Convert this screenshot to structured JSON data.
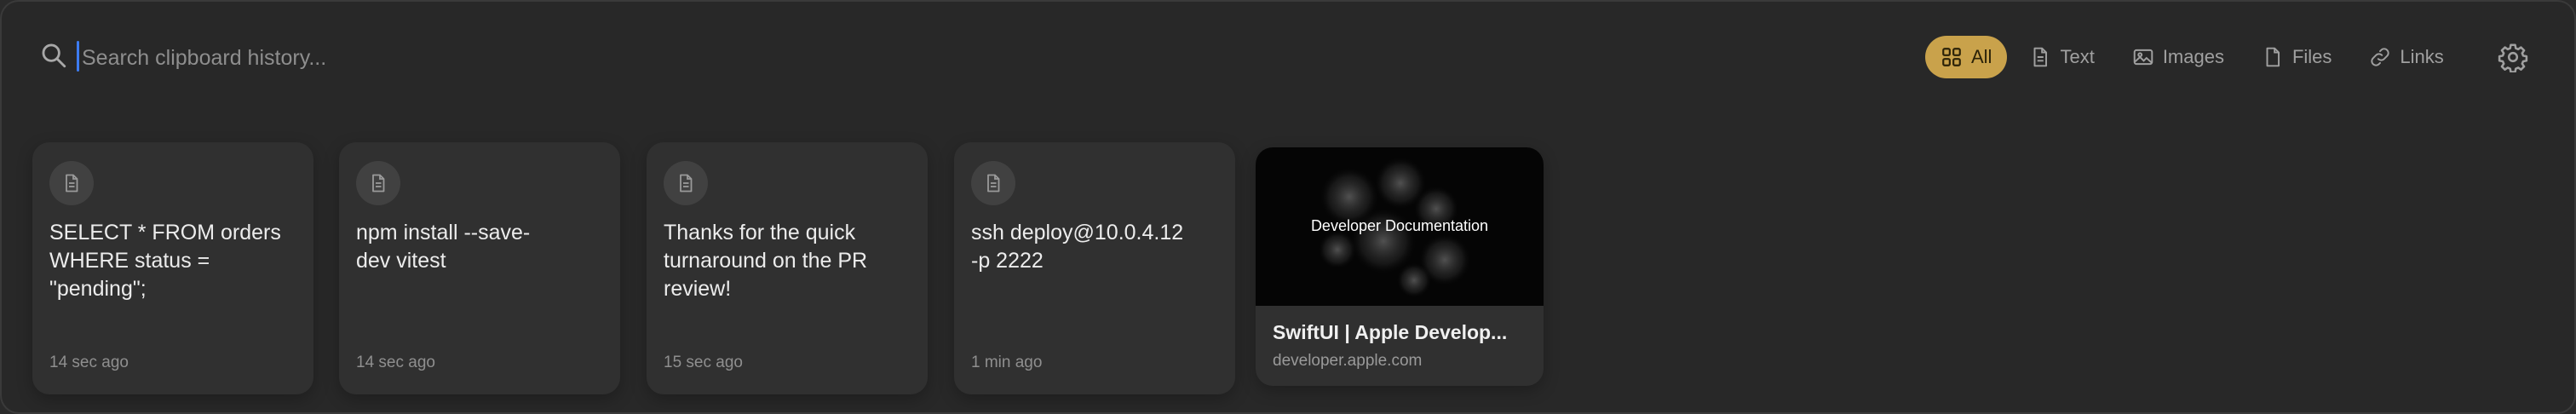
{
  "search": {
    "placeholder": "Search clipboard history..."
  },
  "filters": [
    {
      "label": "All",
      "icon": "grid-icon",
      "active": true
    },
    {
      "label": "Text",
      "icon": "document-icon",
      "active": false
    },
    {
      "label": "Images",
      "icon": "image-icon",
      "active": false
    },
    {
      "label": "Files",
      "icon": "file-icon",
      "active": false
    },
    {
      "label": "Links",
      "icon": "link-icon",
      "active": false
    }
  ],
  "settings_icon": "gear-icon",
  "colors": {
    "accent": "#c9a24b",
    "background": "#282828",
    "card": "#303030",
    "caret": "#3d7cf2"
  },
  "clips": [
    {
      "type": "text",
      "icon": "document-icon",
      "content": "SELECT * FROM orders\nWHERE status =\n\"pending\";",
      "time": "14 sec ago"
    },
    {
      "type": "text",
      "icon": "document-icon",
      "content": "npm install --save-\ndev vitest",
      "time": "14 sec ago"
    },
    {
      "type": "text",
      "icon": "document-icon",
      "content": "Thanks for the quick\nturnaround on the PR\nreview!",
      "time": "15 sec ago"
    },
    {
      "type": "text",
      "icon": "document-icon",
      "content": "ssh deploy@10.0.4.12\n-p 2222",
      "time": "1 min ago"
    }
  ],
  "link_clip": {
    "type": "link",
    "thumbnail_title": " Developer Documentation",
    "title": "SwiftUI | Apple Develop...",
    "domain": "developer.apple.com"
  }
}
